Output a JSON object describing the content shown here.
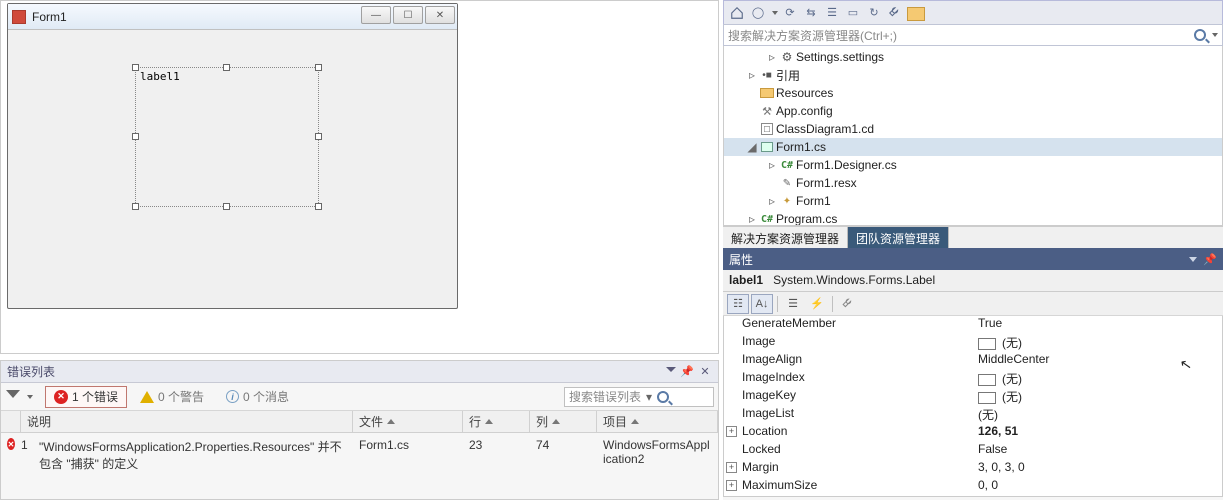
{
  "designer": {
    "form_title": "Form1",
    "label_text": "label1"
  },
  "error_list": {
    "title": "错误列表",
    "filters": {
      "errors": "1 个错误",
      "warnings": "0 个警告",
      "messages": "0 个消息"
    },
    "search_placeholder": "搜索错误列表",
    "columns": {
      "number": "",
      "desc": "说明",
      "file": "文件",
      "line": "行",
      "col": "列",
      "project": "项目"
    },
    "row": {
      "number": "1",
      "desc1": "\"WindowsFormsApplication2.Properties.Resources\" 并不",
      "desc2": "包含 \"捕获\" 的定义",
      "file": "Form1.cs",
      "line": "23",
      "col": "74",
      "project1": "WindowsFormsAppl",
      "project2": "ication2"
    }
  },
  "solution": {
    "search_placeholder": "搜索解决方案资源管理器(Ctrl+;)",
    "items": {
      "settings": "Settings.settings",
      "references": "引用",
      "resources": "Resources",
      "appconfig": "App.config",
      "classdiagram": "ClassDiagram1.cd",
      "form1cs": "Form1.cs",
      "form1designer": "Form1.Designer.cs",
      "form1resx": "Form1.resx",
      "form1cls": "Form1",
      "programcs": "Program.cs"
    },
    "tabs": {
      "explorer": "解决方案资源管理器",
      "team": "团队资源管理器"
    }
  },
  "properties": {
    "title": "属性",
    "selector_name": "label1",
    "selector_type": "System.Windows.Forms.Label",
    "rows": [
      {
        "name": "GenerateMember",
        "value": "True",
        "bold": false,
        "box": false,
        "exp": ""
      },
      {
        "name": "Image",
        "value": "(无)",
        "bold": false,
        "box": true,
        "exp": ""
      },
      {
        "name": "ImageAlign",
        "value": "MiddleCenter",
        "bold": false,
        "box": false,
        "exp": ""
      },
      {
        "name": "ImageIndex",
        "value": "(无)",
        "bold": false,
        "box": true,
        "exp": ""
      },
      {
        "name": "ImageKey",
        "value": "(无)",
        "bold": false,
        "box": true,
        "exp": ""
      },
      {
        "name": "ImageList",
        "value": "(无)",
        "bold": false,
        "box": false,
        "exp": ""
      },
      {
        "name": "Location",
        "value": "126, 51",
        "bold": true,
        "box": false,
        "exp": "+"
      },
      {
        "name": "Locked",
        "value": "False",
        "bold": false,
        "box": false,
        "exp": ""
      },
      {
        "name": "Margin",
        "value": "3, 0, 3, 0",
        "bold": false,
        "box": false,
        "exp": "+"
      },
      {
        "name": "MaximumSize",
        "value": "0, 0",
        "bold": false,
        "box": false,
        "exp": "+"
      }
    ]
  }
}
